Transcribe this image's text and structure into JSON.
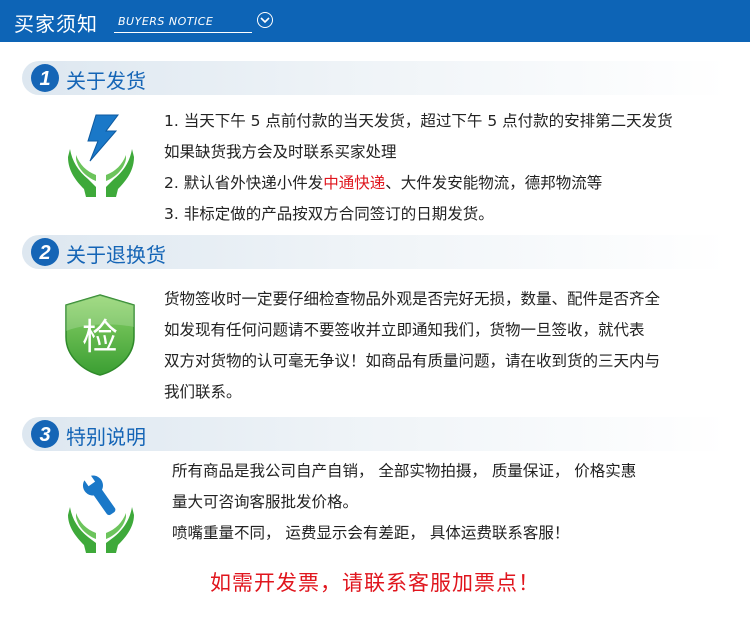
{
  "header": {
    "title": "买家须知",
    "subtitle": "BUYERS NOTICE"
  },
  "sections": [
    {
      "number": "1",
      "title": "关于发货",
      "icon": "lightning-hands-icon",
      "lines": [
        "1. 当天下午 5 点前付款的当天发货，超过下午 5 点付款的安排第二天发货",
        "如果缺货我方会及时联系买家处理",
        "2. 默认省外快递小件发",
        "中通快递",
        "、大件发安能物流，德邦物流等",
        "3. 非标定做的产品按双方合同签订的日期发货。"
      ]
    },
    {
      "number": "2",
      "title": "关于退换货",
      "icon": "inspection-shield-icon",
      "icon_text": "检",
      "lines": [
        "货物签收时一定要仔细检查物品外观是否完好无损，数量、配件是否齐全",
        "如发现有任何问题请不要签收并立即通知我们，货物一旦签收，就代表",
        "双方对货物的认可毫无争议！如商品有质量问题，请在收到货的三天内与",
        "我们联系。"
      ]
    },
    {
      "number": "3",
      "title": "特别说明",
      "icon": "wrench-hands-icon",
      "lines": [
        "所有商品是我公司自产自销，  全部实物拍摄，  质量保证，  价格实惠",
        "量大可咨询客服批发价格。",
        "喷嘴重量不同，  运费显示会有差距，  具体运费联系客服！"
      ]
    }
  ],
  "footer_note": "如需开发票，请联系客服加票点！",
  "colors": {
    "header_blue": "#0d64b6",
    "title_blue": "#1565b6",
    "highlight_red": "#e0151d",
    "green": "#3ea93a"
  }
}
